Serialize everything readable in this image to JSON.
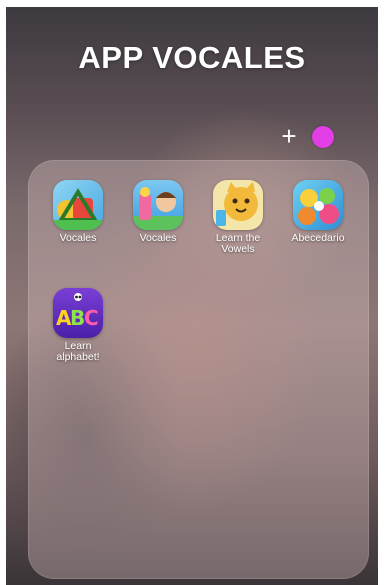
{
  "folder": {
    "title": "APP VOCALES",
    "add_symbol": "+",
    "color_dot": "#e23ee6"
  },
  "apps": [
    {
      "label": "Vocales",
      "icon": "vocales-letters-icon"
    },
    {
      "label": "Vocales",
      "icon": "vocales-kids-icon"
    },
    {
      "label": "Learn the Vowels",
      "icon": "learn-vowels-cat-icon"
    },
    {
      "label": "Abecedario",
      "icon": "abecedario-icon"
    },
    {
      "label": "Learn alphabet!",
      "icon": "abc-alphabet-icon",
      "icon_text": "ABC"
    }
  ]
}
